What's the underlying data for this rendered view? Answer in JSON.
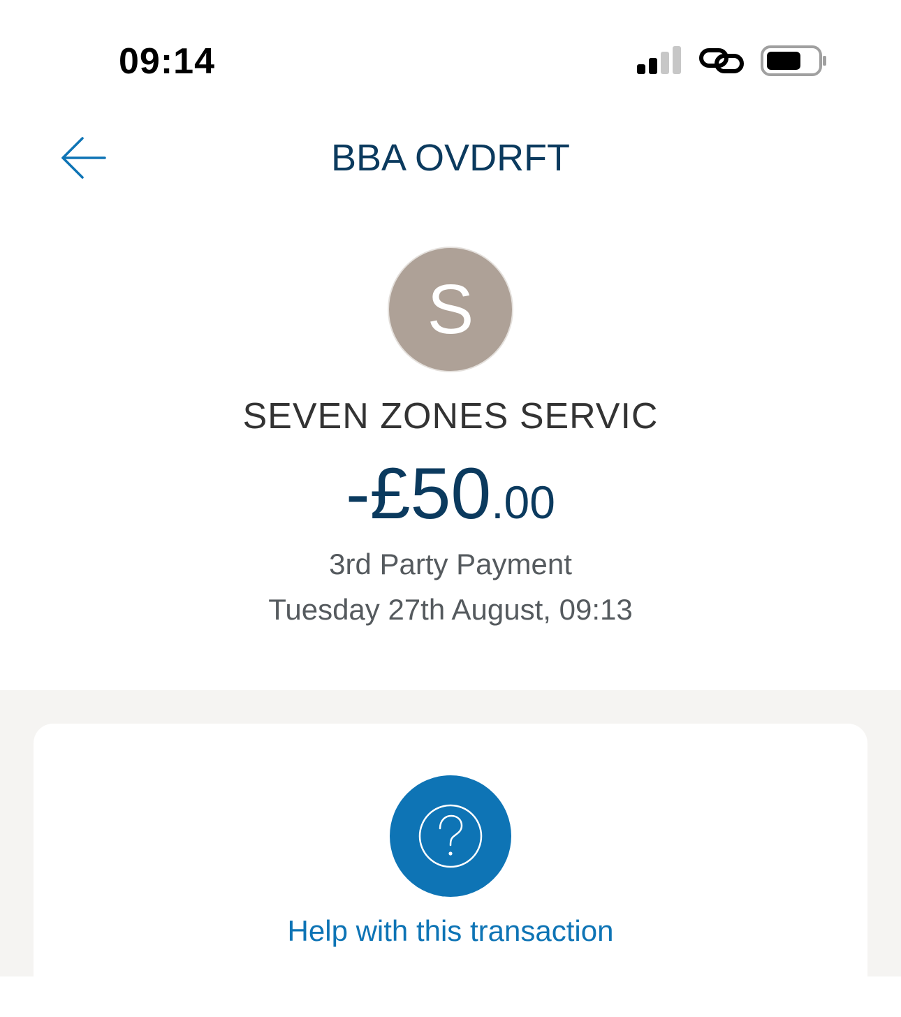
{
  "status_bar": {
    "time": "09:14"
  },
  "header": {
    "title": "BBA OVDRFT"
  },
  "transaction": {
    "avatar_initial": "S",
    "avatar_color": "#aea197",
    "merchant": "SEVEN ZONES SERVIC",
    "amount_main": "-£50",
    "amount_decimal": ".00",
    "type": "3rd Party Payment",
    "date": "Tuesday 27th August, 09:13"
  },
  "help": {
    "label": "Help with this transaction",
    "icon": "question-icon"
  },
  "colors": {
    "brand_dark": "#0b3a5e",
    "accent": "#0e74b5",
    "section_bg": "#f5f4f2"
  }
}
